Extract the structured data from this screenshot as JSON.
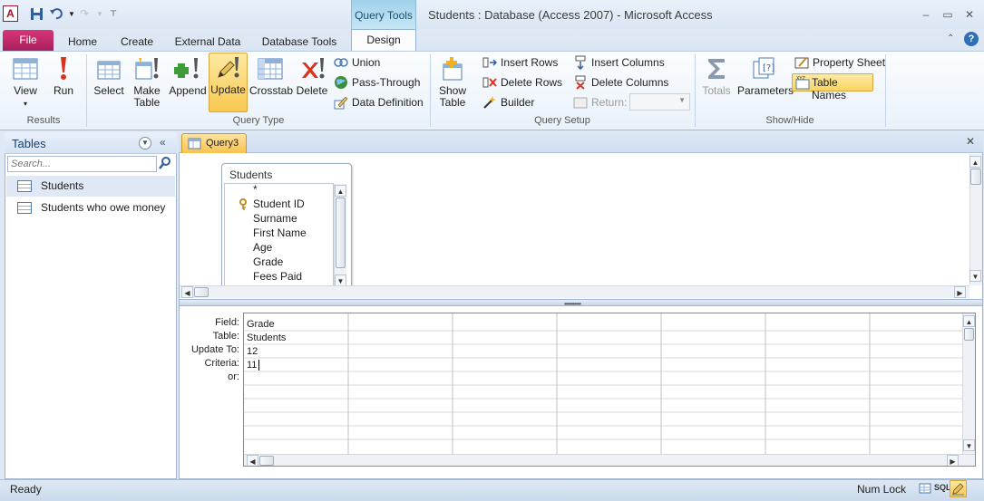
{
  "title_bar": {
    "app_logo": "A",
    "window_title": "Students : Database (Access 2007)  -  Microsoft Access",
    "contextual_header": "Query Tools"
  },
  "ribbon_tabs": [
    "Home",
    "Create",
    "External Data",
    "Database Tools"
  ],
  "file_tab": "File",
  "active_tab": "Design",
  "ribbon": {
    "results": {
      "label": "Results",
      "view": "View",
      "run": "Run"
    },
    "query_type": {
      "label": "Query Type",
      "select": "Select",
      "make_table_1": "Make",
      "make_table_2": "Table",
      "append": "Append",
      "update": "Update",
      "crosstab": "Crosstab",
      "delete": "Delete",
      "union": "Union",
      "pass_through": "Pass-Through",
      "data_definition": "Data Definition"
    },
    "query_setup": {
      "label": "Query Setup",
      "show_table_1": "Show",
      "show_table_2": "Table",
      "insert_rows": "Insert Rows",
      "delete_rows": "Delete Rows",
      "builder": "Builder",
      "insert_columns": "Insert Columns",
      "delete_columns": "Delete Columns",
      "return_label": "Return:"
    },
    "show_hide": {
      "label": "Show/Hide",
      "totals": "Totals",
      "parameters": "Parameters",
      "property_sheet": "Property Sheet",
      "table_names": "Table Names"
    }
  },
  "nav_pane": {
    "title": "Tables",
    "search_placeholder": "Search...",
    "items": [
      {
        "label": "Students",
        "selected": true
      },
      {
        "label": "Students who owe money",
        "selected": false
      }
    ]
  },
  "document": {
    "tab_label": "Query3",
    "table_box": {
      "title": "Students",
      "fields": [
        "*",
        "Student ID",
        "Surname",
        "First Name",
        "Age",
        "Grade",
        "Fees Paid"
      ]
    },
    "qbe": {
      "row_labels": [
        "Field:",
        "Table:",
        "Update To:",
        "Criteria:",
        "or:"
      ],
      "columns": [
        {
          "field": "Grade",
          "table": "Students",
          "update_to": "12",
          "criteria": "11",
          "or": ""
        }
      ]
    }
  },
  "status_bar": {
    "left": "Ready",
    "num_lock": "Num Lock",
    "sql_label": "SQL"
  },
  "colors": {
    "file_tab": "#b8215f",
    "highlight": "#f9c24f",
    "contextual": "#9fd2ea"
  }
}
